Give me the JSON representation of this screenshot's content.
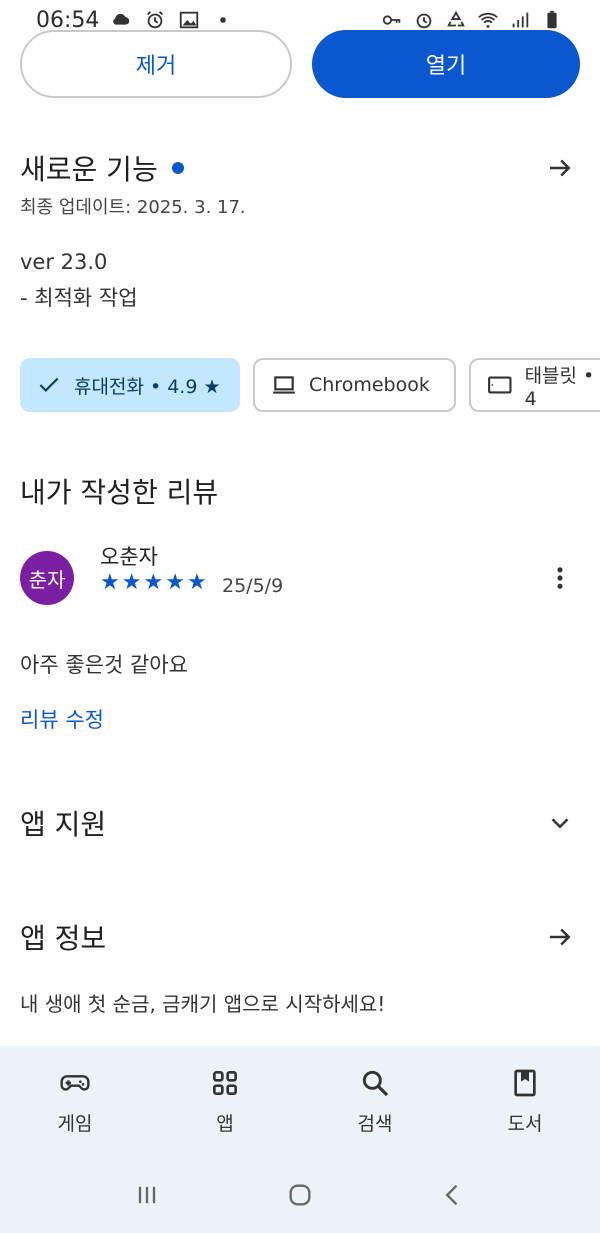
{
  "status_bar": {
    "time": "06:54"
  },
  "actions": {
    "remove_label": "제거",
    "open_label": "열기"
  },
  "whats_new": {
    "title": "새로운 기능",
    "updated": "최종 업데이트: 2025. 3. 17.",
    "version": "ver 23.0",
    "note": "- 최적화 작업"
  },
  "device_chips": [
    {
      "label": "휴대전화 • 4.9 ★",
      "icon": "check-icon",
      "selected": true
    },
    {
      "label": "Chromebook",
      "icon": "laptop-icon",
      "selected": false
    },
    {
      "label": "태블릿 • 4",
      "icon": "tablet-icon",
      "selected": false
    }
  ],
  "my_review": {
    "title": "내가 작성한 리뷰",
    "avatar_text": "춘자",
    "reviewer": "오춘자",
    "rating_stars": 5,
    "date": "25/5/9",
    "text": "아주 좋은것 같아요",
    "edit_label": "리뷰 수정"
  },
  "app_support": {
    "title": "앱 지원"
  },
  "app_info": {
    "title": "앱 정보",
    "description": "내 생애 첫 순금, 금캐기 앱으로 시작하세요!"
  },
  "bottom_nav": [
    {
      "label": "게임",
      "icon": "gamepad-icon"
    },
    {
      "label": "앱",
      "icon": "apps-grid-icon"
    },
    {
      "label": "검색",
      "icon": "search-icon"
    },
    {
      "label": "도서",
      "icon": "bookmark-book-icon"
    }
  ],
  "colors": {
    "accent": "#0b57d0",
    "chip_selected": "#c2e7ff",
    "avatar": "#7b1fa2",
    "nav_bg": "#edf1f8"
  }
}
